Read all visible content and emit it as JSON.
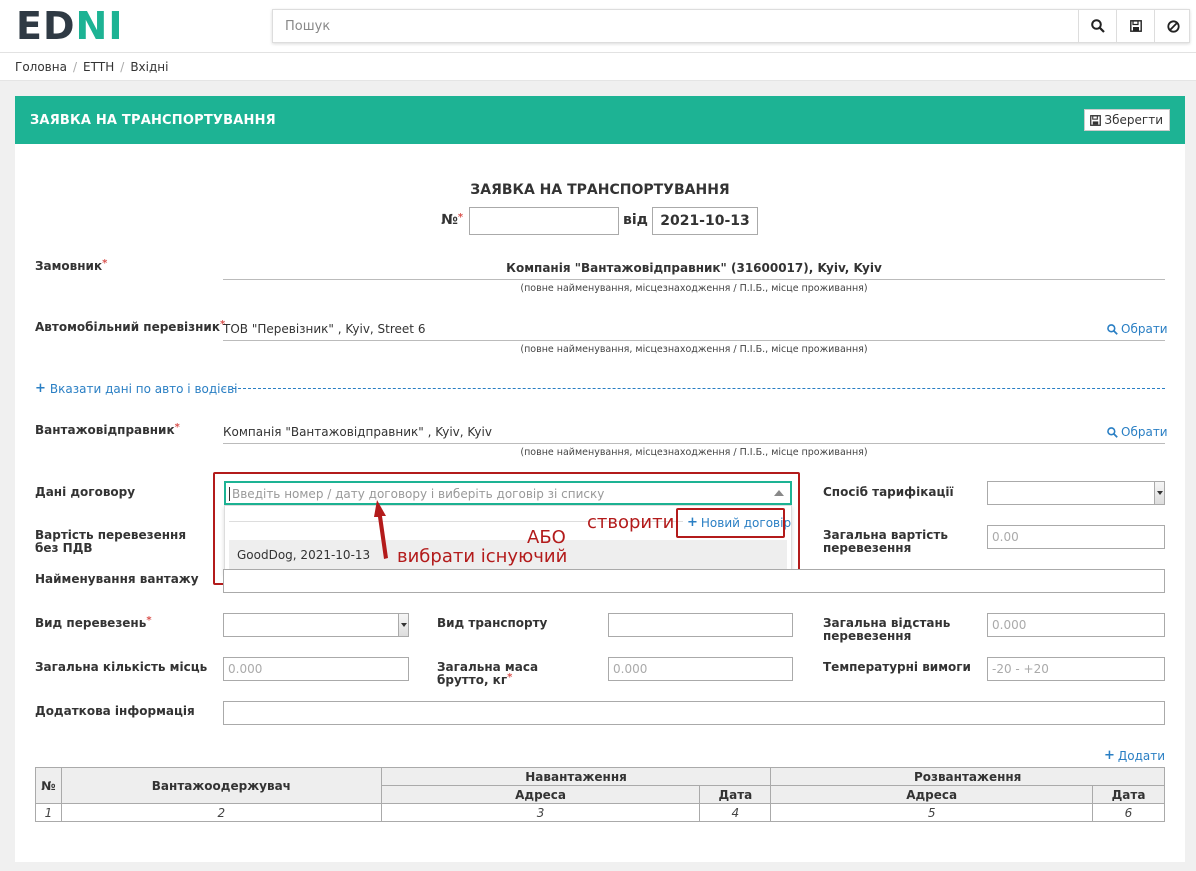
{
  "brand": {
    "left": "ED",
    "right": "NI"
  },
  "search": {
    "placeholder": "Пошук"
  },
  "breadcrumb": [
    "Головна",
    "ЕТТН",
    "Вхідні"
  ],
  "panel": {
    "header": "ЗАЯВКА НА ТРАНСПОРТУВАННЯ",
    "save_label": "Зберегти"
  },
  "form": {
    "title": "ЗАЯВКА НА ТРАНСПОРТУВАННЯ",
    "number_label": "№",
    "number_value": "",
    "from_label": "від",
    "date": "2021-10-13",
    "hint": "(повне найменування, місцезнаходження / П.І.Б., місце проживання)",
    "customer": {
      "label": "Замовник",
      "value": "Компанія \"Вантажовідправник\" (31600017), Kyiv, Kyiv"
    },
    "carrier": {
      "label": "Автомобільний перевізник",
      "value": "ТОВ \"Перевізник\" , Kyiv, Street 6",
      "choose": "Обрати"
    },
    "vehicle_link": "Вказати дані по авто і водієві",
    "shipper": {
      "label": "Вантажовідправник",
      "value": "Компанія \"Вантажовідправник\" , Kyiv, Kyiv",
      "choose": "Обрати"
    },
    "contract": {
      "label": "Дані договору",
      "placeholder": "Введіть номер / дату договору і виберіть договір зі списку",
      "new_contract": "Новий договір",
      "options": [
        "GoodDog, 2021-10-13"
      ]
    },
    "tariff": {
      "label": "Спосіб тарифікації"
    },
    "cost_no_vat": {
      "label": "Вартість перевезення без ПДВ"
    },
    "total_cost": {
      "label": "Загальна вартість перевезення",
      "placeholder": "0.00"
    },
    "cargo_name": {
      "label": "Найменування вантажу"
    },
    "transport_kind": {
      "label": "Вид перевезень"
    },
    "vehicle_type": {
      "label": "Вид транспорту"
    },
    "total_distance": {
      "label": "Загальна відстань перевезення",
      "placeholder": "0.000"
    },
    "places": {
      "label": "Загальна кількість місць",
      "placeholder": "0.000"
    },
    "gross_mass": {
      "label": "Загальна маса брутто, кг",
      "placeholder": "0.000"
    },
    "temperature": {
      "label": "Температурні вимоги",
      "placeholder": "-20 - +20"
    },
    "extra_info": {
      "label": "Додаткова інформація"
    },
    "add_label": "Додати"
  },
  "table": {
    "h_no": "№",
    "h_consignee": "Вантажоодержувач",
    "h_loading": "Навантаження",
    "h_unloading": "Розвантаження",
    "h_address": "Адреса",
    "h_date": "Дата",
    "row": [
      "1",
      "2",
      "3",
      "4",
      "5",
      "6"
    ]
  },
  "annotations": {
    "create": "створити",
    "or": "АБО",
    "choose_existing": "вибрати існуючий"
  },
  "colors": {
    "accent": "#1db394",
    "annotation": "#b31b1b",
    "link": "#2a7fc4"
  }
}
